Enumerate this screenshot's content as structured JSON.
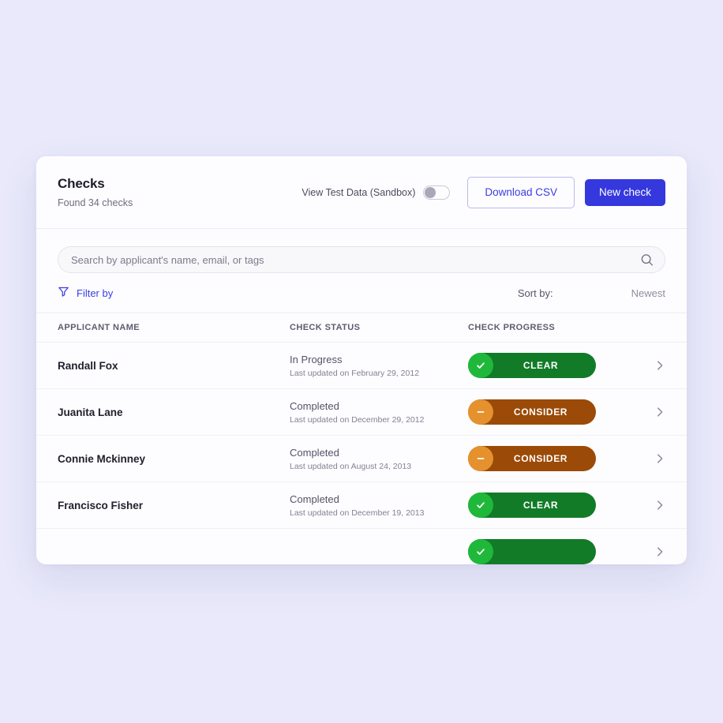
{
  "page": {
    "background_color": "#e9e9fb",
    "accent_color": "#3538dd"
  },
  "header": {
    "title": "Checks",
    "subtitle": "Found 34 checks",
    "sandbox_toggle_label": "View Test Data (Sandbox)",
    "sandbox_toggle_state": "off",
    "download_csv_label": "Download CSV",
    "new_check_label": "New check"
  },
  "search": {
    "placeholder": "Search by applicant's name, email, or tags",
    "value": "",
    "icon": "search-icon"
  },
  "controls": {
    "filter_label": "Filter by",
    "filter_icon": "funnel-icon",
    "sort_label": "Sort by:",
    "sort_value": "Newest"
  },
  "table": {
    "columns": [
      "APPLICANT NAME",
      "CHECK STATUS",
      "CHECK PROGRESS"
    ],
    "rows": [
      {
        "name": "Randall Fox",
        "status": "In Progress",
        "last_updated": "Last updated on February 29, 2012",
        "result": "CLEAR",
        "result_type": "clear",
        "result_icon": "check-icon"
      },
      {
        "name": "Juanita Lane",
        "status": "Completed",
        "last_updated": "Last updated on December 29, 2012",
        "result": "CONSIDER",
        "result_type": "consider",
        "result_icon": "minus-icon"
      },
      {
        "name": "Connie Mckinney",
        "status": "Completed",
        "last_updated": "Last updated on August 24, 2013",
        "result": "CONSIDER",
        "result_type": "consider",
        "result_icon": "minus-icon"
      },
      {
        "name": "Francisco Fisher",
        "status": "Completed",
        "last_updated": "Last updated on December 19, 2013",
        "result": "CLEAR",
        "result_type": "clear",
        "result_icon": "check-icon"
      },
      {
        "name": "",
        "status": "",
        "last_updated": "",
        "result": "",
        "result_type": "clear",
        "result_icon": "check-icon"
      }
    ],
    "row_chevron_icon": "chevron-right-icon"
  },
  "colors": {
    "clear_body": "#127b28",
    "clear_circle": "#20b83a",
    "consider_body": "#9c4a07",
    "consider_circle": "#e5912d",
    "primary_button": "#3538dd"
  }
}
